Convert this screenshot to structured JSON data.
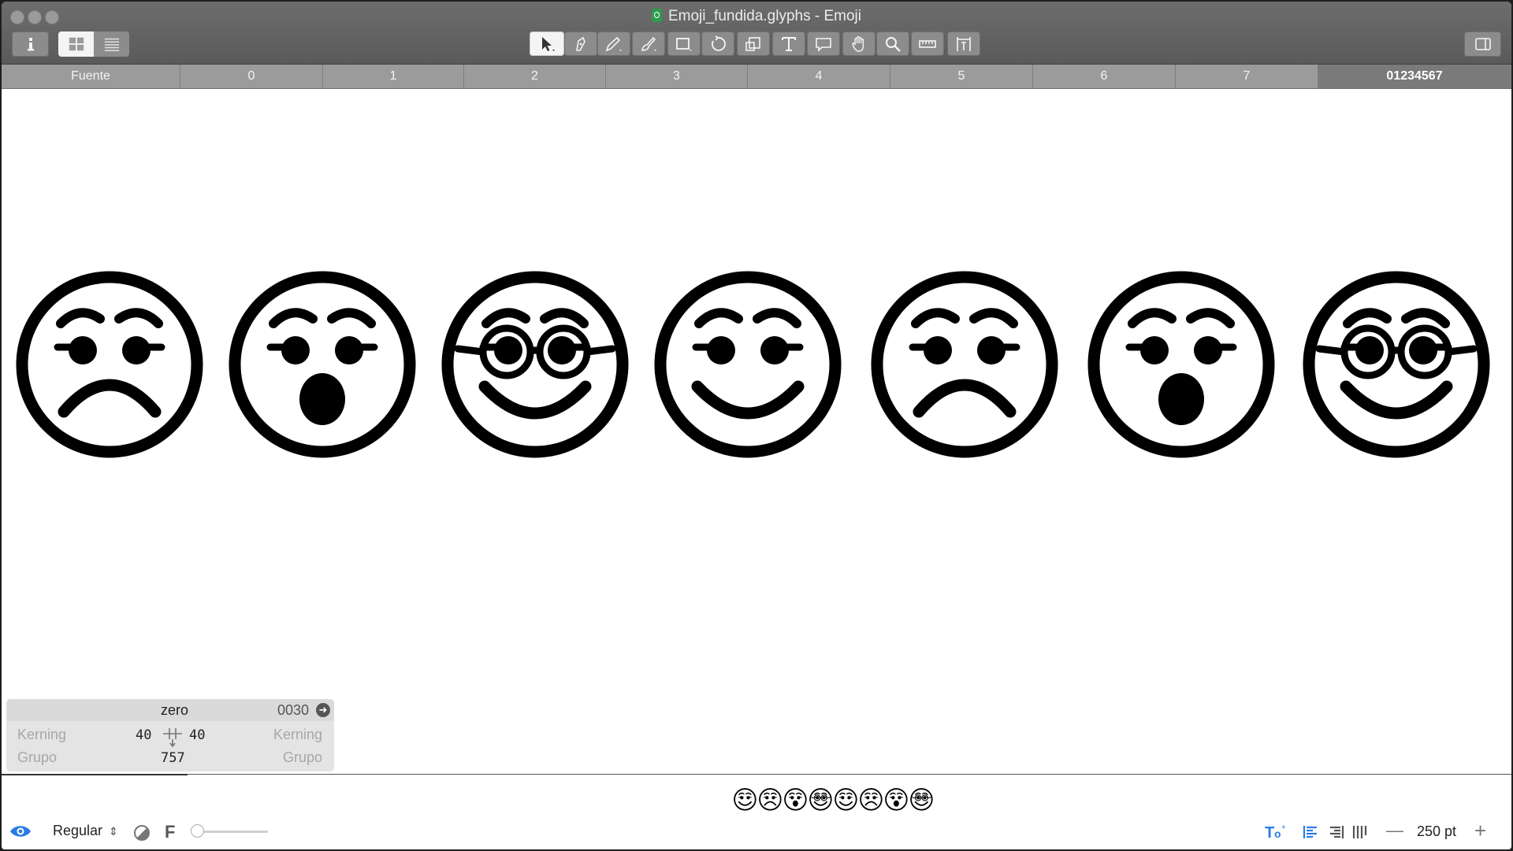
{
  "window": {
    "title": "Emoji_fundida.glyphs - Emoji"
  },
  "toolbar": {
    "tools": [
      {
        "name": "select-tool",
        "icon": "arrow-pointer-icon",
        "active": true
      },
      {
        "name": "draw-tool",
        "icon": "pen-nib-icon"
      },
      {
        "name": "pencil-tool",
        "icon": "pencil-icon"
      },
      {
        "name": "brush-tool",
        "icon": "brush-icon"
      },
      {
        "name": "rectangle-tool",
        "icon": "rectangle-icon"
      },
      {
        "name": "rotate-tool",
        "icon": "rotate-icon"
      },
      {
        "name": "scale-tool",
        "icon": "scale-icon"
      },
      {
        "name": "text-tool",
        "icon": "text-t-icon"
      },
      {
        "name": "annotation-tool",
        "icon": "speech-bubble-icon"
      },
      {
        "name": "hand-tool",
        "icon": "hand-icon"
      },
      {
        "name": "zoom-tool",
        "icon": "magnifier-icon"
      },
      {
        "name": "measure-tool",
        "icon": "ruler-icon"
      },
      {
        "name": "metrics-tool",
        "icon": "metrics-icon"
      }
    ]
  },
  "tabs": [
    {
      "label": "Fuente",
      "active": false
    },
    {
      "label": "0",
      "active": false
    },
    {
      "label": "1",
      "active": false
    },
    {
      "label": "2",
      "active": false
    },
    {
      "label": "3",
      "active": false
    },
    {
      "label": "4",
      "active": false
    },
    {
      "label": "5",
      "active": false
    },
    {
      "label": "6",
      "active": false
    },
    {
      "label": "7",
      "active": false
    },
    {
      "label": "01234567",
      "active": true
    }
  ],
  "glyphs": [
    {
      "mood": "sad",
      "glasses": false
    },
    {
      "mood": "surprised",
      "glasses": false
    },
    {
      "mood": "happy",
      "glasses": true
    },
    {
      "mood": "happy",
      "glasses": false
    },
    {
      "mood": "sad",
      "glasses": false
    },
    {
      "mood": "surprised",
      "glasses": false
    },
    {
      "mood": "happy",
      "glasses": true
    }
  ],
  "info_box": {
    "glyph_name": "zero",
    "unicode": "0030",
    "left_kerning_label": "Kerning",
    "right_kerning_label": "Kerning",
    "left_group_label": "Grupo",
    "right_group_label": "Grupo",
    "lsb": "40",
    "rsb": "40",
    "width": "757"
  },
  "preview": {
    "glyphs": [
      {
        "mood": "happy",
        "glasses": false
      },
      {
        "mood": "sad",
        "glasses": false
      },
      {
        "mood": "surprised",
        "glasses": false
      },
      {
        "mood": "happy",
        "glasses": true
      },
      {
        "mood": "happy",
        "glasses": false
      },
      {
        "mood": "sad",
        "glasses": false
      },
      {
        "mood": "surprised",
        "glasses": false
      },
      {
        "mood": "happy",
        "glasses": true
      }
    ]
  },
  "statusbar": {
    "master": "Regular",
    "zoom": "250 pt",
    "slider_value": 0
  },
  "colors": {
    "accent": "#2c7be5",
    "toolbar": "#6d6d6d",
    "tabstrip": "#9b9b9b"
  }
}
